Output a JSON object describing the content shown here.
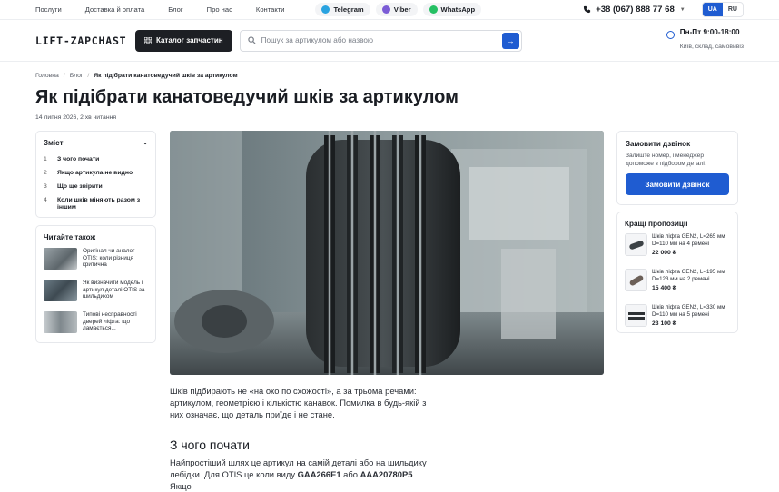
{
  "topbar": {
    "nav": [
      "Послуги",
      "Доставка й оплата",
      "Блог",
      "Про нас",
      "Контакти"
    ],
    "messengers": [
      {
        "label": "Telegram",
        "color": "#2aa3e0"
      },
      {
        "label": "Viber",
        "color": "#7b5cd6"
      },
      {
        "label": "WhatsApp",
        "color": "#25c063"
      }
    ],
    "phone": "+38 (067) 888 77 68",
    "langs": [
      "UA",
      "RU"
    ],
    "active_lang": "UA"
  },
  "header": {
    "logo": "LIFT-ZAPCHAST",
    "catalog_label": "Каталог запчастин",
    "search_placeholder": "Пошук за артикулом або назвою",
    "hours_title": "Пн-Пт 9:00-18:00",
    "hours_sub": "Київ, склад, самовивіз"
  },
  "breadcrumbs": [
    "Головна",
    "Блог",
    "Як підібрати канатоведучий шків за артикулом"
  ],
  "article": {
    "title": "Як підібрати канатоведучий шків за артикулом",
    "meta": "14 липня 2026, 2 хв читання",
    "intro": "Шків підбирають не «на око по схожості», а за трьома речами: артикулом, геометрією і кількістю канавок. Помилка в будь-якій з них означає, що деталь приїде і не стане.",
    "h2": "З чого почати",
    "p2_a": "Найпростіший шлях це артикул на самій деталі або на шильдику лебідки. Для OTIS це коли виду ",
    "p2_b": "GAA266E1",
    "p2_c": " або ",
    "p2_d": "AAA20780P5",
    "p2_e": ". Якщо"
  },
  "toc": {
    "title": "Зміст",
    "items": [
      {
        "n": "1",
        "label": "З чого почати"
      },
      {
        "n": "2",
        "label": "Якщо артикула не видно"
      },
      {
        "n": "3",
        "label": "Що ще звірити"
      },
      {
        "n": "4",
        "label": "Коли шків міняють разом з іншим"
      }
    ]
  },
  "also": {
    "title": "Читайте також",
    "items": [
      {
        "label": "Оригінал чи аналог OTIS: коли різниця критична"
      },
      {
        "label": "Як визначити модель і артикул деталі OTIS за шильдиком"
      },
      {
        "label": "Типові несправності дверей ліфта: що ламається..."
      }
    ]
  },
  "callback": {
    "title": "Замовити дзвінок",
    "sub": "Залиште номер, і менеджер допоможе з підбором деталі.",
    "button": "Замовити дзвінок"
  },
  "best": {
    "title": "Кращі пропозиції",
    "items": [
      {
        "name": "Шків ліфта GEN2, L=265 мм D=110 мм на 4 ремені",
        "price": "22 000 ₴"
      },
      {
        "name": "Шків ліфта GEN2, L=195 мм D=123 мм на 2 ремені",
        "price": "15 400 ₴"
      },
      {
        "name": "Шків ліфта GEN2, L=330 мм D=110 мм на 5 ремені",
        "price": "23 100 ₴"
      }
    ]
  },
  "colors": {
    "accent": "#1f5cd1",
    "dark": "#1d1f24"
  }
}
